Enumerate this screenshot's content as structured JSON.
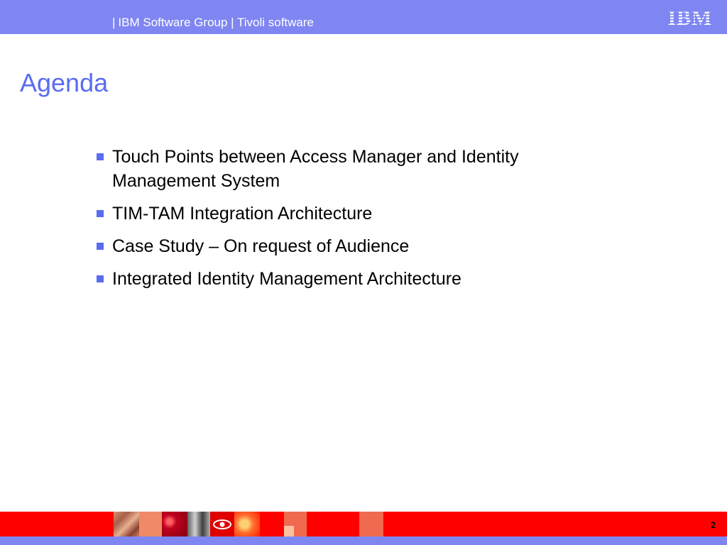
{
  "header": {
    "separator": "|",
    "group_text": "IBM Software Group | Tivoli software",
    "logo_text": "IBM",
    "background_color": "#7f86f2"
  },
  "slide": {
    "title": "Agenda",
    "title_color": "#5a6cf0",
    "bullet_color": "#5a6cf0",
    "items": [
      "Touch Points between Access Manager and Identity Management System",
      "TIM-TAM Integration Architecture",
      "Case Study – On request of Audience",
      "Integrated Identity Management Architecture"
    ]
  },
  "footer": {
    "page_number": "2",
    "bar_color": "#ff0000",
    "strip_color": "#7f86f2",
    "image_strip_icon": "eye-icon"
  }
}
